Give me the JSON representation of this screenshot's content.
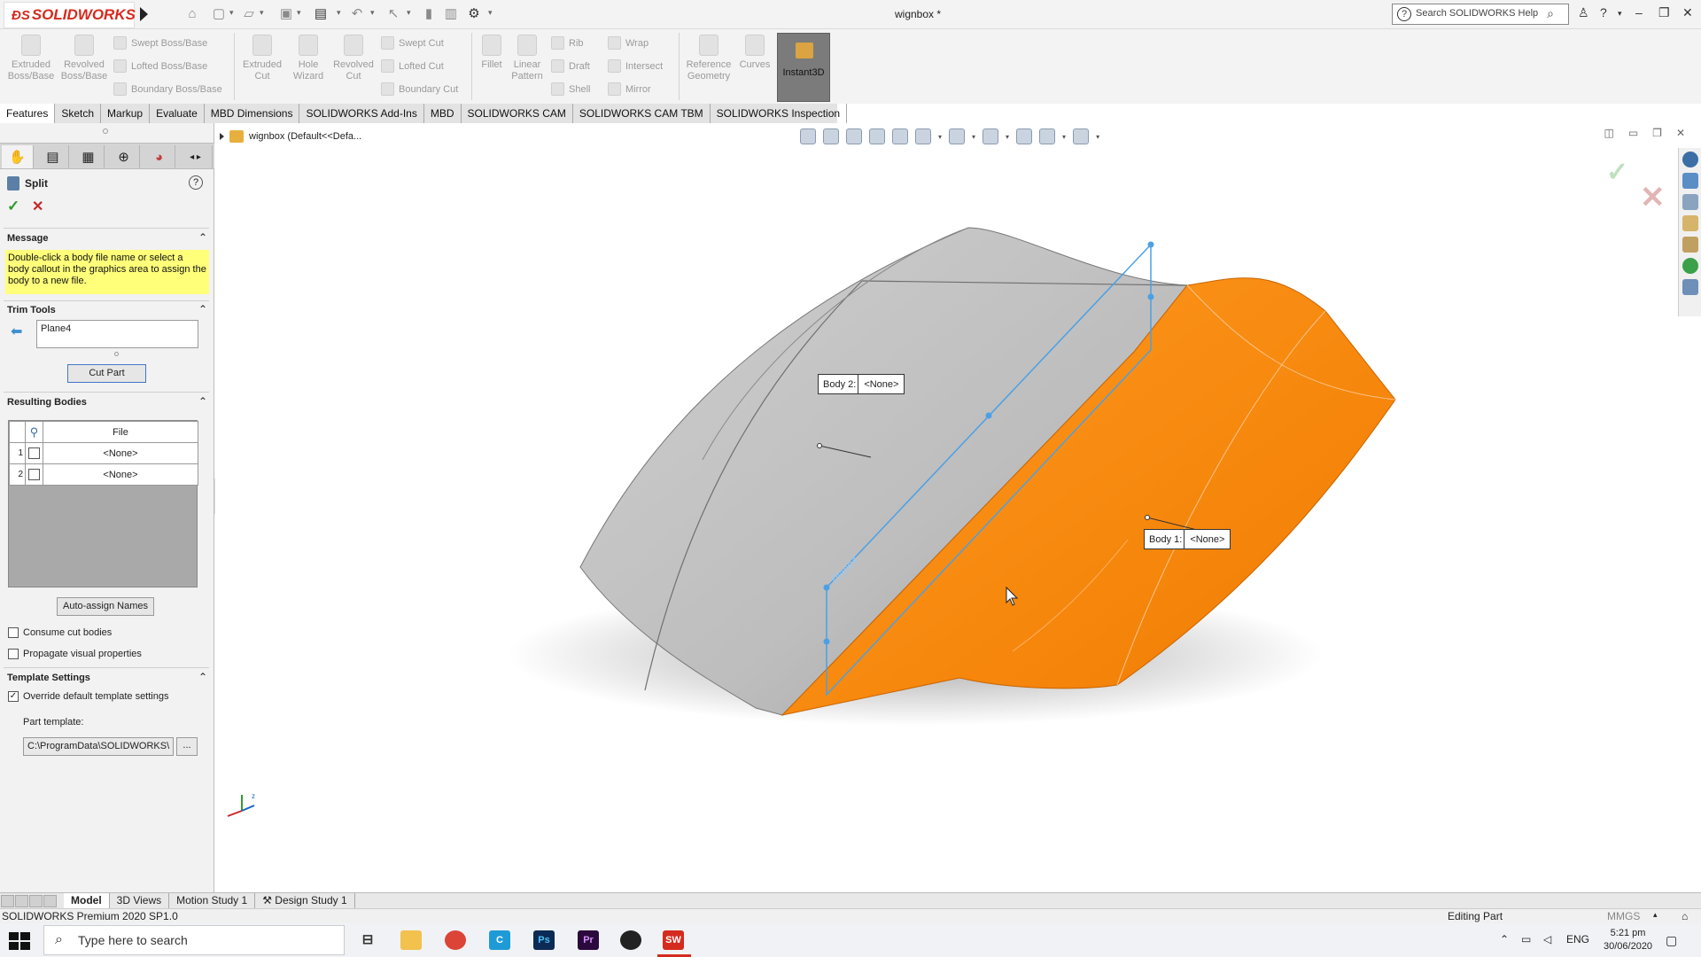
{
  "app": {
    "logo": "SOLIDWORKS",
    "document_title": "wignbox *",
    "help_search_placeholder": "Search SOLIDWORKS Help"
  },
  "ribbon": {
    "large_buttons": [
      {
        "label": "Extruded Boss/Base"
      },
      {
        "label": "Revolved Boss/Base"
      },
      {
        "label": "Extruded Cut"
      },
      {
        "label": "Hole Wizard"
      },
      {
        "label": "Revolved Cut"
      },
      {
        "label": "Fillet"
      },
      {
        "label": "Linear Pattern"
      },
      {
        "label": "Reference Geometry"
      },
      {
        "label": "Curves"
      }
    ],
    "small_buttons": {
      "swept_boss": "Swept Boss/Base",
      "lofted_boss": "Lofted Boss/Base",
      "boundary_boss": "Boundary Boss/Base",
      "swept_cut": "Swept Cut",
      "lofted_cut": "Lofted Cut",
      "boundary_cut": "Boundary Cut",
      "rib": "Rib",
      "draft": "Draft",
      "shell": "Shell",
      "wrap": "Wrap",
      "intersect": "Intersect",
      "mirror": "Mirror"
    },
    "instant3d": "Instant3D"
  },
  "command_tabs": [
    "Features",
    "Sketch",
    "Markup",
    "Evaluate",
    "MBD Dimensions",
    "SOLIDWORKS Add-Ins",
    "MBD",
    "SOLIDWORKS CAM",
    "SOLIDWORKS CAM TBM",
    "SOLIDWORKS Inspection"
  ],
  "property_manager": {
    "title": "Split",
    "help": "?",
    "message_header": "Message",
    "message": "Double-click a body file name or select a body callout in the graphics area to assign the body to a new file.",
    "trim_tools_header": "Trim Tools",
    "trim_tool_value": "Plane4",
    "cut_part_button": "Cut Part",
    "resulting_bodies_header": "Resulting Bodies",
    "table_header": "File",
    "rows": [
      {
        "num": "1",
        "file": "<None>"
      },
      {
        "num": "2",
        "file": "<None>"
      }
    ],
    "auto_assign_button": "Auto-assign Names",
    "consume_cut_bodies": "Consume cut bodies",
    "propagate_visual": "Propagate visual properties",
    "template_header": "Template Settings",
    "override_template": "Override default template settings",
    "part_template_label": "Part template:",
    "part_template_path": "C:\\ProgramData\\SOLIDWORKS\\",
    "browse": "..."
  },
  "viewport": {
    "tree_root": "wignbox  (Default<<Defa...",
    "plane_label": "Plane4",
    "callouts": [
      {
        "label": "Body  2:",
        "value": "<None>"
      },
      {
        "label": "Body  1:",
        "value": "<None>"
      }
    ],
    "colors": {
      "orange_body": "#ff8a10",
      "gray_body": "#bdbdbd",
      "plane_line": "#4aa0e6"
    }
  },
  "bottom_tabs": [
    "Model",
    "3D Views",
    "Motion Study 1",
    "Design Study 1"
  ],
  "status": {
    "left": "SOLIDWORKS Premium 2020 SP1.0",
    "mode": "Editing Part",
    "units": "MMGS"
  },
  "taskbar": {
    "search_placeholder": "Type here to search",
    "lang": "ENG",
    "time": "5:21 pm",
    "date": "30/06/2020",
    "app_icons": [
      "task-view",
      "file-explorer",
      "chrome",
      "c-app",
      "photoshop",
      "premiere",
      "obs",
      "solidworks"
    ]
  }
}
